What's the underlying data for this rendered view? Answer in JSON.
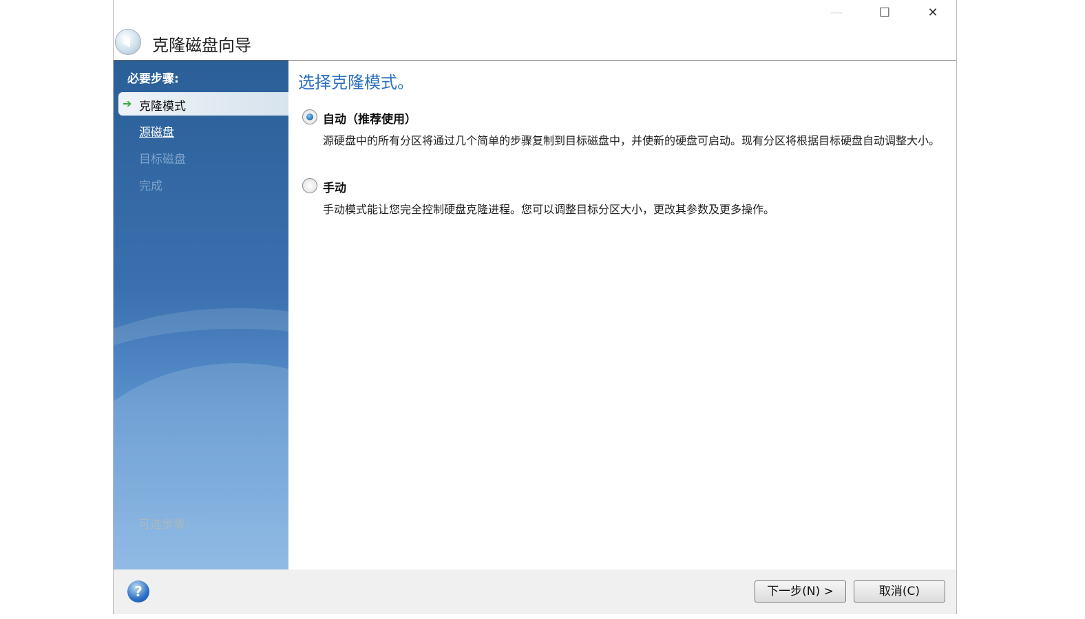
{
  "window": {
    "title": "克隆磁盘向导",
    "minimize": "—",
    "maximize": "☐",
    "close": "✕"
  },
  "sidebar": {
    "required_label": "必要步骤:",
    "steps": [
      {
        "label": "克隆模式",
        "state": "current"
      },
      {
        "label": "源磁盘",
        "state": "next"
      },
      {
        "label": "目标磁盘",
        "state": "disabled"
      },
      {
        "label": "完成",
        "state": "disabled"
      }
    ],
    "optional_label": "可选步骤:"
  },
  "main": {
    "heading": "选择克隆模式。",
    "options": [
      {
        "label": "自动（推荐使用）",
        "selected": true,
        "description": "源硬盘中的所有分区将通过几个简单的步骤复制到目标磁盘中，并使新的硬盘可启动。现有分区将根据目标硬盘自动调整大小。"
      },
      {
        "label": "手动",
        "selected": false,
        "description": "手动模式能让您完全控制硬盘克隆进程。您可以调整目标分区大小，更改其参数及更多操作。"
      }
    ]
  },
  "footer": {
    "help": "?",
    "next": "下一步(N) >",
    "cancel": "取消(C)"
  }
}
